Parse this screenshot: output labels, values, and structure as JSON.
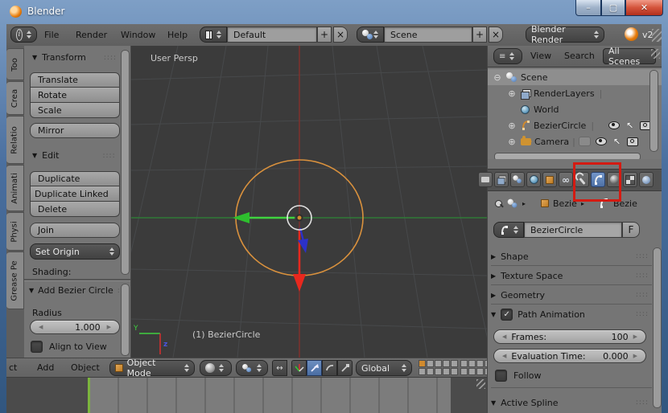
{
  "window": {
    "title": "Blender"
  },
  "icons": {
    "grip": "::::",
    "cursor": "↖",
    "plus": "+",
    "close": "×",
    "collapse": "▼",
    "expand": "▶",
    "check": "✓",
    "tree_collapse": "⊖",
    "tree_expand": "⊕",
    "crumb_sep": "▸",
    "pipe": "|",
    "pivot": "↔",
    "infinity": "∞",
    "left_small": "◀",
    "right_small": "▶",
    "info": "i",
    "list": "≡"
  },
  "menubar": {
    "menus": [
      "File",
      "Render",
      "Window",
      "Help"
    ],
    "layout_value": "Default",
    "scene_value": "Scene",
    "engine_value": "Blender Render",
    "version": "v2"
  },
  "tool_tabs": [
    "Too",
    "Crea",
    "Relatio",
    "Animati",
    "Physi",
    "Grease Pe"
  ],
  "tool_shelf": {
    "transform_title": "Transform",
    "transform_buttons": [
      "Translate",
      "Rotate",
      "Scale"
    ],
    "mirror_button": "Mirror",
    "edit_title": "Edit",
    "edit_buttons": [
      "Duplicate",
      "Duplicate Linked",
      "Delete"
    ],
    "join_button": "Join",
    "set_origin": "Set Origin",
    "shading_label": "Shading:",
    "add_panel_title": "Add Bezier Circle",
    "radius_label": "Radius",
    "radius_value": "1.000",
    "align_to_view": "Align to View"
  },
  "viewport": {
    "view_label": "User Persp",
    "status_label": "(1) BezierCircle",
    "axis_y": "Y",
    "axis_z": "z",
    "circle_color": "#d9913d",
    "axis_red": "#83302b",
    "axis_green": "#2f7a36"
  },
  "view_header": {
    "menus": [
      "ct",
      "Add",
      "Object"
    ],
    "mode": "Object Mode",
    "orientation": "Global"
  },
  "outliner": {
    "menus": [
      "View",
      "Search"
    ],
    "scenes_filter": "All Scenes",
    "rows": [
      {
        "label": "Scene"
      },
      {
        "label": "RenderLayers"
      },
      {
        "label": "World"
      },
      {
        "label": "BezierCircle"
      },
      {
        "label": "Camera"
      }
    ]
  },
  "properties": {
    "tabs": [
      "render",
      "render-layers",
      "scene",
      "world",
      "object",
      "constraints",
      "modifiers",
      "object-data",
      "material",
      "texture",
      "physics"
    ],
    "active_tab": "object-data",
    "breadcrumb": {
      "object": "Bezie",
      "data": "Bezie"
    },
    "name_value": "BezierCircle",
    "fake_user": "F",
    "sections": {
      "shape": "Shape",
      "texture_space": "Texture Space",
      "geometry": "Geometry",
      "path_animation": "Path Animation",
      "active_spline": "Active Spline"
    },
    "path_animation": {
      "frames_label": "Frames:",
      "frames_value": "100",
      "eval_label": "Evaluation Time:",
      "eval_value": "0.000",
      "follow_label": "Follow"
    }
  },
  "annotation_color": "#d41b12"
}
